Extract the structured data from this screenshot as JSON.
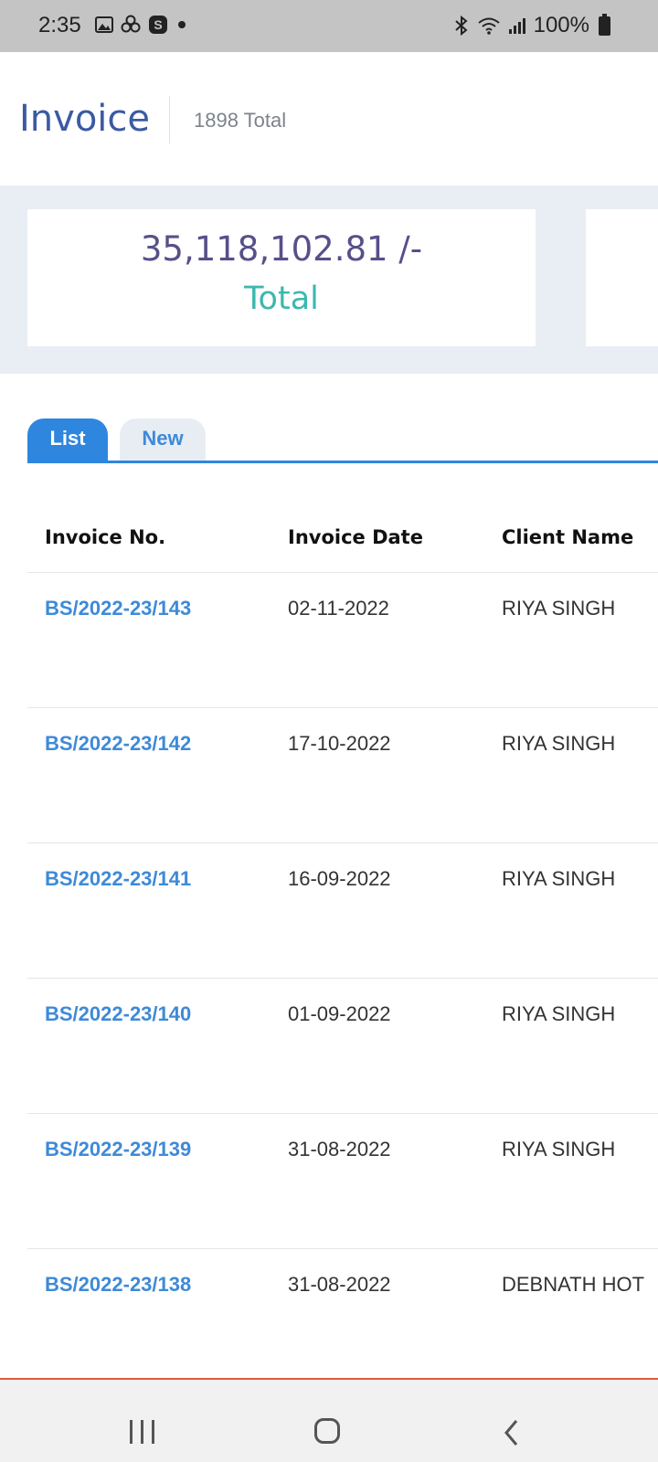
{
  "status_bar": {
    "time": "2:35",
    "battery": "100%",
    "left_icons": [
      "gallery-icon",
      "pinwheel-icon",
      "s-app-icon",
      "dot-icon"
    ],
    "right_icons": [
      "bluetooth-icon",
      "wifi-icon",
      "signal-icon",
      "battery-icon"
    ]
  },
  "header": {
    "title": "Invoice",
    "total_count": "1898 Total"
  },
  "summary": {
    "amount": "35,118,102.81 /-",
    "label": "Total"
  },
  "tabs": [
    {
      "label": "List",
      "active": true
    },
    {
      "label": "New",
      "active": false
    }
  ],
  "table": {
    "columns": [
      "Invoice No.",
      "Invoice Date",
      "Client Name"
    ],
    "rows": [
      {
        "no": "BS/2022-23/143",
        "date": "02-11-2022",
        "client": "RIYA SINGH"
      },
      {
        "no": "BS/2022-23/142",
        "date": "17-10-2022",
        "client": "RIYA SINGH"
      },
      {
        "no": "BS/2022-23/141",
        "date": "16-09-2022",
        "client": "RIYA SINGH"
      },
      {
        "no": "BS/2022-23/140",
        "date": "01-09-2022",
        "client": "RIYA SINGH"
      },
      {
        "no": "BS/2022-23/139",
        "date": "31-08-2022",
        "client": "RIYA SINGH"
      },
      {
        "no": "BS/2022-23/138",
        "date": "31-08-2022",
        "client": "DEBNATH HOT"
      }
    ]
  },
  "colors": {
    "accent_blue": "#2f86de",
    "title_blue": "#3b5aa3",
    "total_teal": "#3cb8ae",
    "amount_purple": "#56508a"
  },
  "nav": [
    "recent-apps-icon",
    "home-icon",
    "back-icon"
  ]
}
